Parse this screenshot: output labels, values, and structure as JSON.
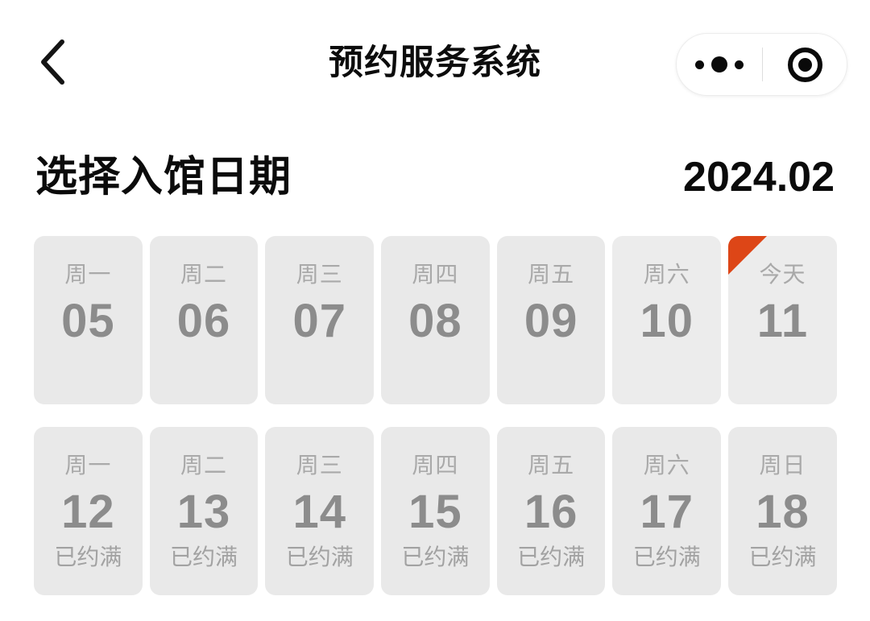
{
  "navbar": {
    "back_icon": "chevron-left-icon",
    "title": "预约服务系统",
    "capsule": {
      "more_icon": "more-dots-icon",
      "target_icon": "target-circle-icon"
    }
  },
  "section": {
    "title": "选择入馆日期",
    "month": "2024.02"
  },
  "theme": {
    "today_flag_color": "#dd4617",
    "card_bg": "#e9e9e9",
    "card_bg_light": "#ececec",
    "day_num_color": "#8c8c8c",
    "day_label_color": "#a9a9a9",
    "status_color": "#a2a2a2",
    "page_bg": "#ffffff",
    "text_color": "#0b0b0b"
  },
  "calendar": {
    "rows": [
      {
        "days": [
          {
            "label": "周一",
            "num": "05",
            "status": "",
            "today": false,
            "light": false
          },
          {
            "label": "周二",
            "num": "06",
            "status": "",
            "today": false,
            "light": false
          },
          {
            "label": "周三",
            "num": "07",
            "status": "",
            "today": false,
            "light": false
          },
          {
            "label": "周四",
            "num": "08",
            "status": "",
            "today": false,
            "light": false
          },
          {
            "label": "周五",
            "num": "09",
            "status": "",
            "today": false,
            "light": false
          },
          {
            "label": "周六",
            "num": "10",
            "status": "",
            "today": false,
            "light": true
          },
          {
            "label": "今天",
            "num": "11",
            "status": "",
            "today": true,
            "light": true
          }
        ]
      },
      {
        "days": [
          {
            "label": "周一",
            "num": "12",
            "status": "已约满",
            "today": false,
            "light": false
          },
          {
            "label": "周二",
            "num": "13",
            "status": "已约满",
            "today": false,
            "light": false
          },
          {
            "label": "周三",
            "num": "14",
            "status": "已约满",
            "today": false,
            "light": false
          },
          {
            "label": "周四",
            "num": "15",
            "status": "已约满",
            "today": false,
            "light": false
          },
          {
            "label": "周五",
            "num": "16",
            "status": "已约满",
            "today": false,
            "light": false
          },
          {
            "label": "周六",
            "num": "17",
            "status": "已约满",
            "today": false,
            "light": false
          },
          {
            "label": "周日",
            "num": "18",
            "status": "已约满",
            "today": false,
            "light": false
          }
        ]
      }
    ]
  }
}
